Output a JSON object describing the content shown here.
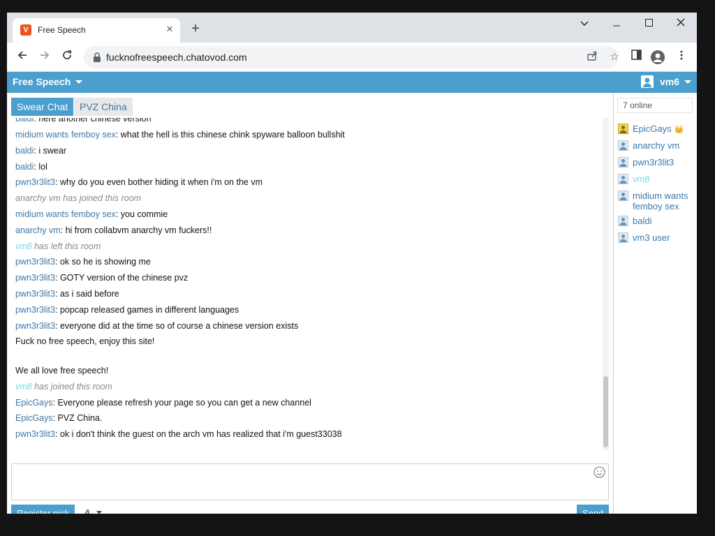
{
  "browser": {
    "tab_title": "Free Speech",
    "tab_favicon": "V",
    "url": "fucknofreespeech.chatovod.com"
  },
  "icons": {
    "favicon": "chatovod-v-icon",
    "lock": "lock-icon",
    "emoji": "smiley-icon"
  },
  "colors": {
    "accent": "#4a9fcf",
    "nick": "#3d77a8",
    "guest_nick": "#7fd4e8",
    "system_text": "#888888",
    "favicon": "#e8541f"
  },
  "header": {
    "room_title": "Free Speech",
    "username": "vm6"
  },
  "tabs": [
    {
      "label": "Swear Chat"
    },
    {
      "label": "PVZ China"
    }
  ],
  "messages": [
    {
      "nick": "baldi",
      "sep": ": ",
      "text": "here another chinese version"
    },
    {
      "nick": "midium wants femboy sex",
      "sep": ": ",
      "text": "what the hell is this chinese chink spyware balloon bullshit"
    },
    {
      "nick": "baldi",
      "sep": ": ",
      "text": "i swear"
    },
    {
      "nick": "baldi",
      "sep": ": ",
      "text": "lol"
    },
    {
      "nick": "pwn3r3lit3",
      "sep": ": ",
      "text": "why do you even bother hiding it when i'm on the vm"
    },
    {
      "nick": "",
      "sep": "",
      "text": "anarchy vm has joined this room",
      "system": true
    },
    {
      "nick": "midium wants femboy sex",
      "sep": ": ",
      "text": "you commie"
    },
    {
      "nick": "anarchy vm",
      "sep": ": ",
      "text": "hi from collabvm anarchy vm fuckers!!"
    },
    {
      "nick": "vm8",
      "sep": " ",
      "text": "has left this room",
      "system": true
    },
    {
      "nick": "pwn3r3lit3",
      "sep": ": ",
      "text": "ok so he is showing me"
    },
    {
      "nick": "pwn3r3lit3",
      "sep": ": ",
      "text": "GOTY version of the chinese pvz"
    },
    {
      "nick": "pwn3r3lit3",
      "sep": ": ",
      "text": "as i said before"
    },
    {
      "nick": "pwn3r3lit3",
      "sep": ": ",
      "text": "popcap released games in different languages"
    },
    {
      "nick": "pwn3r3lit3",
      "sep": ": ",
      "text": "everyone did at the time so of course a chinese version exists"
    },
    {
      "nick": "",
      "sep": "",
      "text": "Fuck no free speech, enjoy this site!"
    },
    {
      "nick": "",
      "sep": "",
      "text": "We all love free speech!"
    },
    {
      "nick": "vm8",
      "sep": " ",
      "text": "has joined this room",
      "system": true
    },
    {
      "nick": "EpicGays",
      "sep": ": ",
      "text": "Everyone please refresh your page so you can get a new channel"
    },
    {
      "nick": "EpicGays",
      "sep": ": ",
      "text": "PVZ China."
    },
    {
      "nick": "pwn3r3lit3",
      "sep": ": ",
      "text": "ok i don't think the guest on the arch vm has realized that i'm guest33038"
    }
  ],
  "composer": {
    "register_label": "Register nick",
    "font_label": "A",
    "send_label": "Send"
  },
  "sidebar": {
    "online_count": "7 online",
    "users": [
      {
        "name": "EpicGays",
        "crown": "👑",
        "admin": true
      },
      {
        "name": "anarchy vm"
      },
      {
        "name": "pwn3r3lit3"
      },
      {
        "name": "vm8",
        "guest": true
      },
      {
        "name": "midium wants femboy sex",
        "wrap": true
      },
      {
        "name": "baldi"
      },
      {
        "name": "vm3 user"
      }
    ]
  }
}
